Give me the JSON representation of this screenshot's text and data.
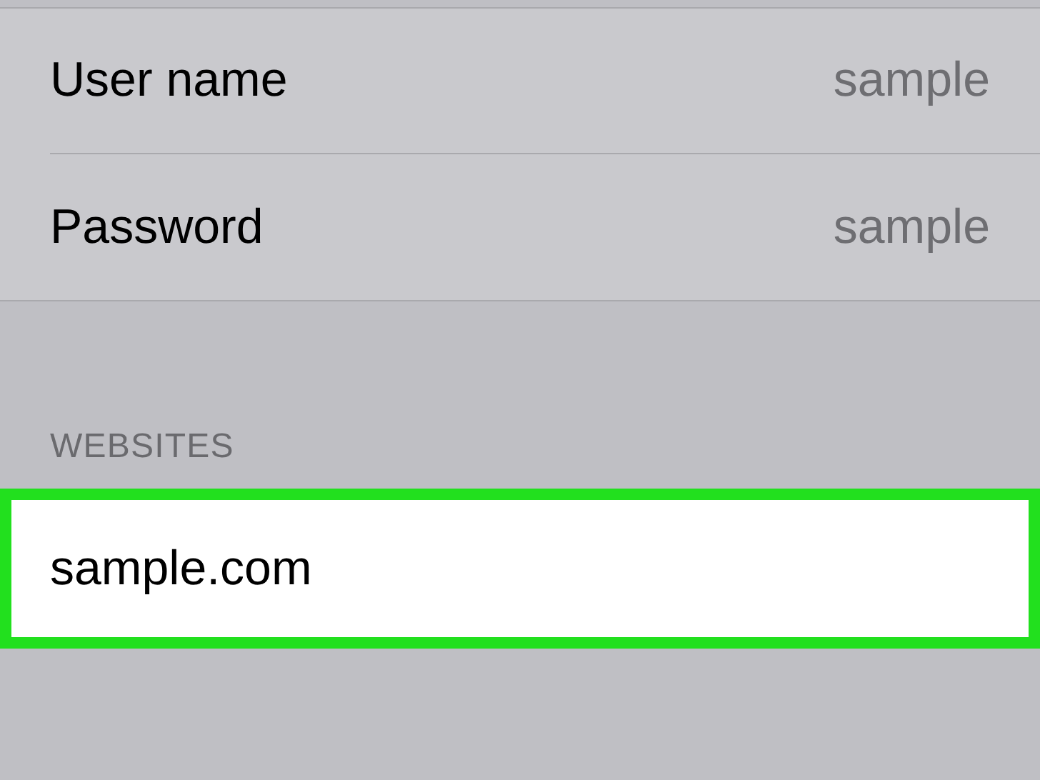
{
  "credentials": [
    {
      "label": "User name",
      "value": "sample"
    },
    {
      "label": "Password",
      "value": "sample"
    }
  ],
  "websites": {
    "header": "WEBSITES",
    "items": [
      {
        "label": "sample.com",
        "highlighted": true
      }
    ]
  }
}
